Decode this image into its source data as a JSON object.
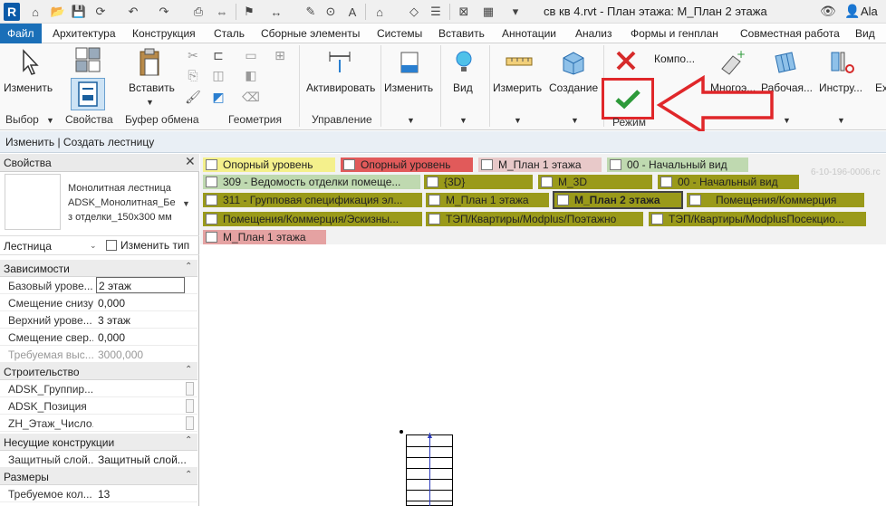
{
  "app": {
    "title": "св кв 4.rvt - План этажа: М_План 2 этажа",
    "logo": "R",
    "user": "Ala"
  },
  "ribbon_tabs": [
    "Файл",
    "Архитектура",
    "Конструкция",
    "Сталь",
    "Сборные элементы",
    "Системы",
    "Вставить",
    "Аннотации",
    "Анализ",
    "Формы и генплан",
    "Совместная работа",
    "Вид"
  ],
  "ribbon": {
    "modify": "Изменить",
    "insert": "Вставить",
    "activate": "Активировать",
    "modify2": "Изменить",
    "view": "Вид",
    "measure": "Измерить",
    "create": "Создание",
    "components": "Компо...",
    "multi": "Многоэ...",
    "workplane": "Рабочая...",
    "tools": "Инстру...",
    "ext": "Ex",
    "groups": {
      "select": "Выбор",
      "properties": "Свойства",
      "clipboard": "Буфер обмена",
      "geometry": "Геометрия",
      "control": "Управление",
      "mode": "Режим"
    }
  },
  "context_bar": "Изменить | Создать лестницу",
  "properties": {
    "title": "Свойства",
    "type_lines": [
      "Монолитная лестница",
      "ADSK_Монолитная_Бе",
      "з отделки_150x300 мм"
    ],
    "category": "Лестница",
    "edit_type": "Изменить тип",
    "groups": {
      "constraints": "Зависимости",
      "construction": "Строительство",
      "structural": "Несущие конструкции",
      "dimensions": "Размеры"
    },
    "rows": {
      "base_level": {
        "k": "Базовый урове...",
        "v": "2 этаж"
      },
      "base_offset": {
        "k": "Смещение снизу",
        "v": "0,000"
      },
      "top_level": {
        "k": "Верхний урове...",
        "v": "3 этаж"
      },
      "top_offset": {
        "k": "Смещение свер...",
        "v": "0,000"
      },
      "req_height": {
        "k": "Требуемая выс...",
        "v": "3000,000"
      },
      "group": {
        "k": "ADSK_Группир..."
      },
      "position": {
        "k": "ADSK_Позиция"
      },
      "floor_num": {
        "k": "ZH_Этаж_Число..."
      },
      "protective": {
        "k": "Защитный слой...",
        "v": "Защитный слой..."
      },
      "risers": {
        "k": "Требуемое кол...",
        "v": "13"
      }
    }
  },
  "view_tabs": [
    "Опорный уровень",
    "Опорный уровень",
    "М_План 1 этажа",
    "00 - Начальный вид",
    "309 - Ведомость отделки помеще...",
    "{3D}",
    "М_3D",
    "00 - Начальный вид",
    "311 - Групповая спецификация эл...",
    "М_План 1 этажа",
    "М_План 2 этажа",
    "Помещения/Коммерция",
    "Помещения/Коммерция/Эскизны...",
    "ТЭП/Квартиры/Modplus/Поэтажно",
    "ТЭП/Квартиры/ModplusПосекцио...",
    "М_План 1 этажа"
  ],
  "bg_coord": "6-10-196-0006.rc",
  "colors": {
    "accent": "#1a6fb8",
    "highlight_arrow": "#e0272a",
    "confirm": "#2e9a3a",
    "cancel": "#d62a2a",
    "tab_olive": "#9a9a1a",
    "tab_yellow": "#f4f08c",
    "tab_red": "#e15a5a",
    "tab_green": "#bfd9b0",
    "tab_pink": "#e8c9c9",
    "tab_rose": "#e5a2a2"
  }
}
